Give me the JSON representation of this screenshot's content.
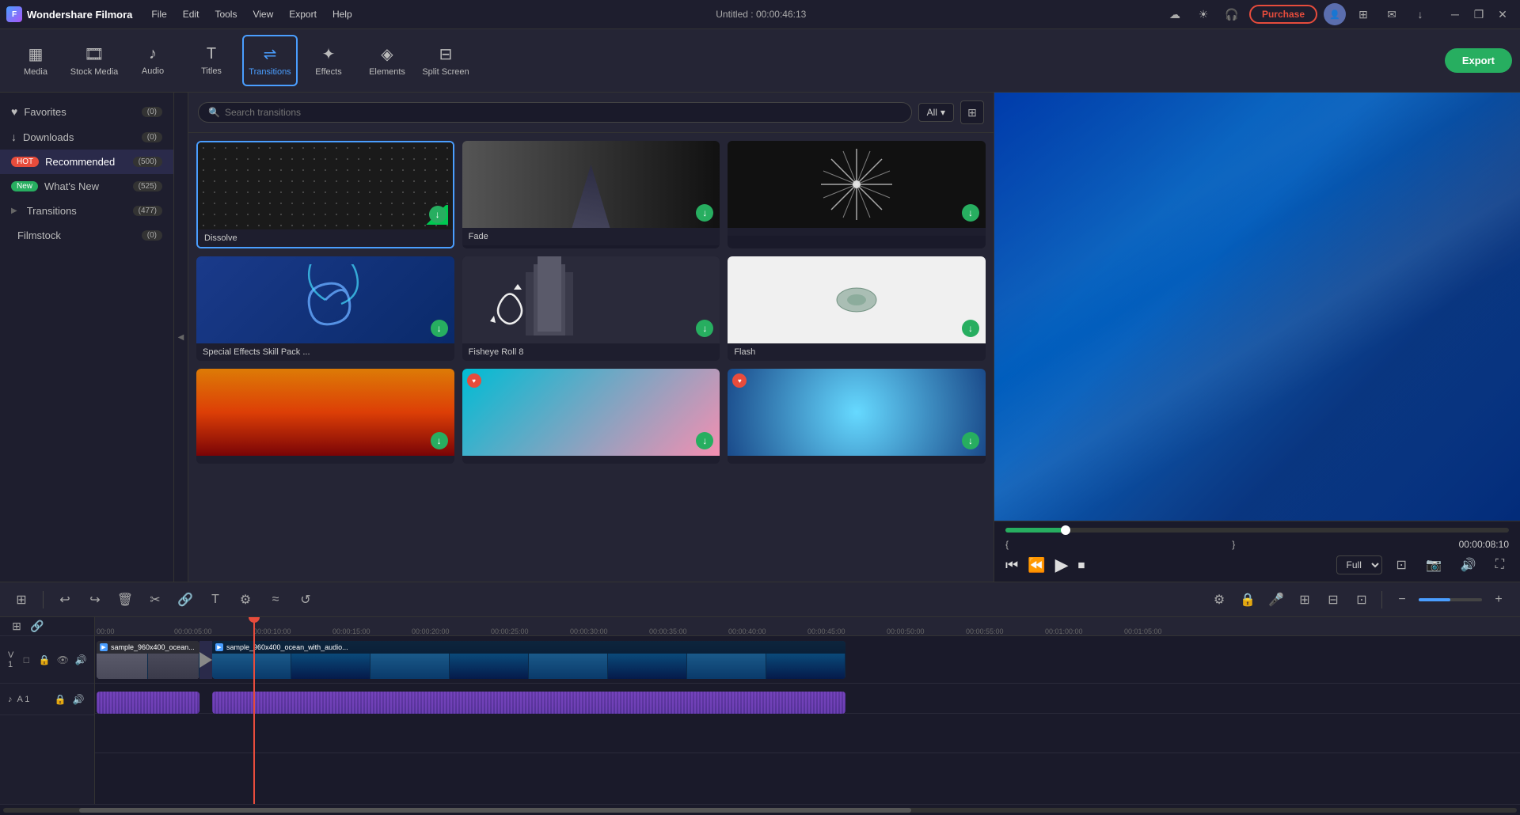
{
  "app": {
    "name": "Wondershare Filmora",
    "logo_letter": "F",
    "title": "Untitled : 00:00:46:13"
  },
  "menu": {
    "items": [
      "File",
      "Edit",
      "Tools",
      "View",
      "Export",
      "Help"
    ]
  },
  "titlebar": {
    "purchase_label": "Purchase",
    "window_controls": [
      "─",
      "❐",
      "✕"
    ]
  },
  "toolbar": {
    "items": [
      {
        "id": "media",
        "label": "Media",
        "icon": "▦"
      },
      {
        "id": "stock",
        "label": "Stock Media",
        "icon": "🎞"
      },
      {
        "id": "audio",
        "label": "Audio",
        "icon": "♪"
      },
      {
        "id": "titles",
        "label": "Titles",
        "icon": "T"
      },
      {
        "id": "transitions",
        "label": "Transitions",
        "icon": "⇌"
      },
      {
        "id": "effects",
        "label": "Effects",
        "icon": "✦"
      },
      {
        "id": "elements",
        "label": "Elements",
        "icon": "◈"
      },
      {
        "id": "split",
        "label": "Split Screen",
        "icon": "⊟"
      }
    ],
    "export_label": "Export"
  },
  "sidebar": {
    "items": [
      {
        "id": "favorites",
        "label": "Favorites",
        "icon": "♥",
        "count": "(0)",
        "badge_type": "normal"
      },
      {
        "id": "downloads",
        "label": "Downloads",
        "icon": "↓",
        "count": "(0)",
        "badge_type": "normal"
      },
      {
        "id": "recommended",
        "label": "Recommended",
        "icon": "HOT",
        "count": "(500)",
        "badge_type": "hot"
      },
      {
        "id": "whatsnew",
        "label": "What's New",
        "icon": "New",
        "count": "(525)",
        "badge_type": "new"
      },
      {
        "id": "transitions",
        "label": "Transitions",
        "icon": "▶",
        "count": "(477)",
        "badge_type": "normal"
      },
      {
        "id": "filmstock",
        "label": "Filmstock",
        "icon": "",
        "count": "(0)",
        "badge_type": "normal"
      }
    ]
  },
  "search": {
    "placeholder": "Search transitions",
    "filter_label": "All"
  },
  "grid": {
    "items": [
      {
        "id": "dissolve",
        "label": "Dissolve",
        "type": "dissolve",
        "selected": true,
        "premium": false,
        "downloadable": true
      },
      {
        "id": "fade",
        "label": "Fade",
        "type": "fade",
        "selected": false,
        "premium": false,
        "downloadable": true
      },
      {
        "id": "starburst",
        "label": "",
        "type": "starburst",
        "selected": false,
        "premium": false,
        "downloadable": true
      },
      {
        "id": "special",
        "label": "Special Effects Skill Pack ...",
        "type": "swirl",
        "selected": false,
        "premium": false,
        "downloadable": true
      },
      {
        "id": "fisheye",
        "label": "Fisheye Roll 8",
        "type": "fisheye",
        "selected": false,
        "premium": false,
        "downloadable": true
      },
      {
        "id": "flash",
        "label": "Flash",
        "type": "flash",
        "selected": false,
        "premium": false,
        "downloadable": true
      },
      {
        "id": "fire",
        "label": "",
        "type": "fire",
        "selected": false,
        "premium": false,
        "downloadable": true
      },
      {
        "id": "teal",
        "label": "",
        "type": "teal",
        "selected": false,
        "premium": true,
        "downloadable": true
      },
      {
        "id": "glow",
        "label": "",
        "type": "glow",
        "selected": false,
        "premium": true,
        "downloadable": true
      }
    ]
  },
  "preview": {
    "time_current": "00:00:08:10",
    "quality": "Full",
    "bracket_left": "{",
    "bracket_right": "}"
  },
  "timeline": {
    "toolbar_buttons": [
      "⊞",
      "↩",
      "↪",
      "🗑",
      "✂",
      "🔗",
      "T",
      "⚙",
      "≈",
      "↺"
    ],
    "right_buttons": [
      "⚙",
      "🔒",
      "🎤",
      "⊞",
      "⊟",
      "⊡",
      "−",
      "+"
    ],
    "tracks": [
      {
        "id": "v1",
        "type": "video",
        "label": "V 1",
        "icons": [
          "□",
          "🔒",
          "👁",
          "🔊"
        ],
        "clips": [
          {
            "name": "sample_960x400_ocean...",
            "start_pct": 0,
            "width_pct": 13.5,
            "color": "gray"
          },
          {
            "name": "sample_960x400_ocean_with_audio...",
            "start_pct": 14,
            "width_pct": 64,
            "color": "blue"
          }
        ]
      },
      {
        "id": "a1",
        "type": "audio",
        "label": "A 1",
        "icons": [
          "♪",
          "🔒",
          "🔊"
        ]
      }
    ],
    "time_markers": [
      "00:00",
      "00:00:05:00",
      "00:00:10:00",
      "00:00:15:00",
      "00:00:20:00",
      "00:00:25:00",
      "00:00:30:00",
      "00:00:35:00",
      "00:00:40:00",
      "00:00:45:00",
      "00:00:50:00",
      "00:00:55:00",
      "00:01:00:00",
      "00:01:05:00"
    ],
    "playhead_pct": 18
  }
}
